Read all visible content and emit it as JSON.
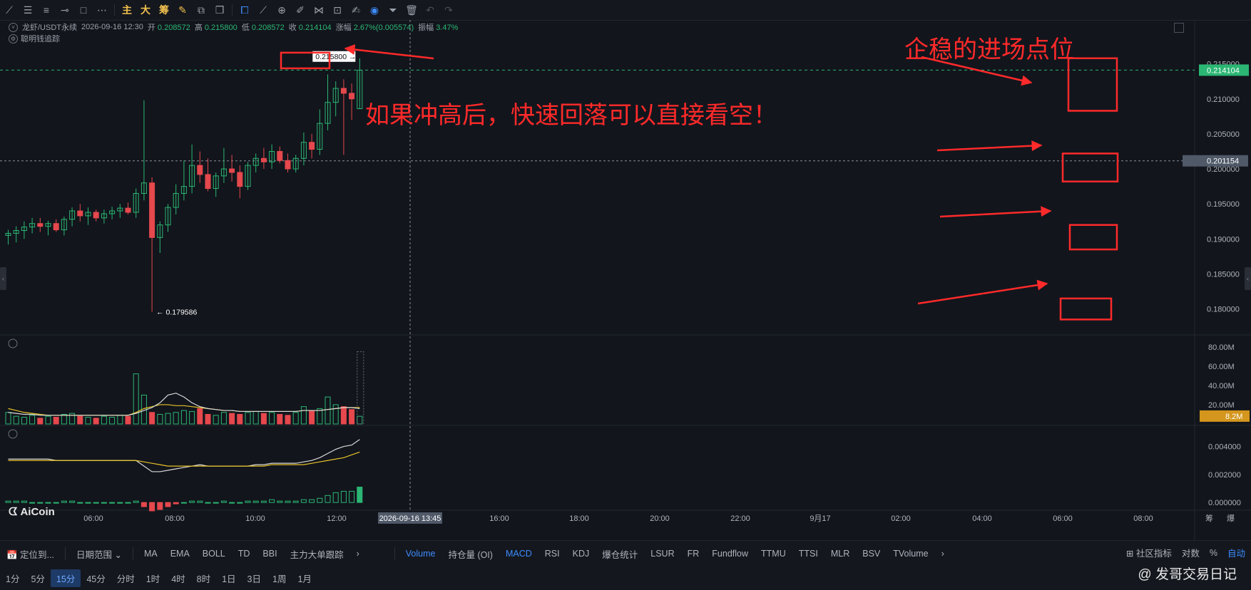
{
  "toolbar": {
    "icons": [
      "line-icon",
      "hline-icon",
      "parallel-icon",
      "ray-icon",
      "rect-icon",
      "dot-more-icon",
      "main-icon",
      "big-icon",
      "chip-icon",
      "pen-icon",
      "copy-icon",
      "layers-icon",
      "magnet-icon",
      "ruler-icon",
      "zoom-icon",
      "brush-icon",
      "mirror-icon",
      "lock-icon",
      "edit-icon",
      "eye-icon",
      "filter-icon",
      "trash-icon",
      "undo-icon",
      "redo-icon"
    ],
    "label_main": "主",
    "label_big": "大",
    "label_chip": "筹"
  },
  "info": {
    "symbol": "龙虾/USDT永续",
    "datetime": "2026-09-16 12:30",
    "open_label": "开",
    "open": "0.208572",
    "high_label": "高",
    "high": "0.215800",
    "low_label": "低",
    "low": "0.208572",
    "close_label": "收",
    "close": "0.214104",
    "change_label": "涨幅",
    "change": "2.67%(0.005574)",
    "amplitude_label": "振幅",
    "amplitude": "3.47%"
  },
  "indicator_label": "聪明钱追踪",
  "annotations": {
    "title": "企稳的进场点位",
    "note": "如果冲高后，快速回落可以直接看空！"
  },
  "chart_data": {
    "type": "candlestick",
    "interval": "15分",
    "price_axis": {
      "ticks": [
        "0.215000",
        "0.210000",
        "0.205000",
        "0.200000",
        "0.195000",
        "0.190000",
        "0.185000",
        "0.180000"
      ],
      "min": 0.1765,
      "max": 0.2172
    },
    "time_axis": {
      "ticks": [
        "06:00",
        "08:00",
        "10:00",
        "12:00",
        "2026-09-16 13:45",
        "16:00",
        "18:00",
        "20:00",
        "22:00",
        "9月17",
        "02:00",
        "04:00",
        "06:00",
        "08:00"
      ]
    },
    "current_price": "0.214104",
    "crosshair_price": "0.201154",
    "crosshair_time": "2026-09-16 13:45",
    "high_marker": "0.215800",
    "low_marker": "0.179586",
    "highlight_levels": [
      "0.214104 / 0.210000",
      "0.201154 / 0.200000",
      "0.190000",
      "0.180000"
    ],
    "candles": [
      [
        0.1905,
        0.1913,
        0.1892,
        0.1908
      ],
      [
        0.1908,
        0.1918,
        0.1895,
        0.1912
      ],
      [
        0.1912,
        0.1925,
        0.19,
        0.1917
      ],
      [
        0.1917,
        0.193,
        0.1908,
        0.1922
      ],
      [
        0.1922,
        0.193,
        0.191,
        0.1918
      ],
      [
        0.1918,
        0.1926,
        0.1905,
        0.1922
      ],
      [
        0.1922,
        0.1928,
        0.191,
        0.1913
      ],
      [
        0.1913,
        0.1932,
        0.1905,
        0.1928
      ],
      [
        0.1928,
        0.1945,
        0.1918,
        0.194
      ],
      [
        0.194,
        0.195,
        0.1925,
        0.1933
      ],
      [
        0.1933,
        0.1945,
        0.192,
        0.1938
      ],
      [
        0.1938,
        0.1942,
        0.1925,
        0.193
      ],
      [
        0.193,
        0.1942,
        0.1922,
        0.1936
      ],
      [
        0.1936,
        0.1946,
        0.1928,
        0.194
      ],
      [
        0.194,
        0.195,
        0.193,
        0.1944
      ],
      [
        0.1944,
        0.1952,
        0.1935,
        0.1938
      ],
      [
        0.1938,
        0.1972,
        0.193,
        0.1965
      ],
      [
        0.1965,
        0.2098,
        0.1955,
        0.198
      ],
      [
        0.198,
        0.1988,
        0.1796,
        0.1902
      ],
      [
        0.1902,
        0.1925,
        0.188,
        0.192
      ],
      [
        0.192,
        0.195,
        0.191,
        0.1945
      ],
      [
        0.1945,
        0.1978,
        0.1935,
        0.1965
      ],
      [
        0.1965,
        0.2012,
        0.1955,
        0.1975
      ],
      [
        0.1975,
        0.2035,
        0.1965,
        0.2005
      ],
      [
        0.2005,
        0.2025,
        0.198,
        0.1992
      ],
      [
        0.1992,
        0.2015,
        0.1968,
        0.1972
      ],
      [
        0.1972,
        0.1995,
        0.196,
        0.199
      ],
      [
        0.199,
        0.203,
        0.198,
        0.2
      ],
      [
        0.2,
        0.202,
        0.1982,
        0.1995
      ],
      [
        0.1995,
        0.2005,
        0.1958,
        0.1975
      ],
      [
        0.1975,
        0.201,
        0.197,
        0.2005
      ],
      [
        0.2005,
        0.2022,
        0.1995,
        0.2015
      ],
      [
        0.2015,
        0.203,
        0.2,
        0.201
      ],
      [
        0.201,
        0.2035,
        0.2,
        0.2025
      ],
      [
        0.2025,
        0.2032,
        0.2008,
        0.2012
      ],
      [
        0.2012,
        0.2022,
        0.1995,
        0.2
      ],
      [
        0.2,
        0.202,
        0.1995,
        0.2015
      ],
      [
        0.2015,
        0.2052,
        0.2005,
        0.2038
      ],
      [
        0.2038,
        0.205,
        0.2015,
        0.2028
      ],
      [
        0.2028,
        0.2085,
        0.202,
        0.2065
      ],
      [
        0.2065,
        0.2135,
        0.2055,
        0.2095
      ],
      [
        0.2095,
        0.2125,
        0.2075,
        0.2115
      ],
      [
        0.2115,
        0.2128,
        0.202,
        0.2108
      ],
      [
        0.2108,
        0.2122,
        0.207,
        0.21
      ],
      [
        0.2086,
        0.2158,
        0.2086,
        0.2141
      ]
    ],
    "volume_axis": {
      "ticks": [
        "80.00M",
        "60.00M",
        "40.00M",
        "20.00M"
      ],
      "max": 88,
      "current": "8.2M"
    },
    "volumes": [
      12,
      8,
      7,
      9,
      6,
      8,
      7,
      10,
      11,
      8,
      7,
      6,
      8,
      7,
      9,
      8,
      52,
      30,
      12,
      10,
      11,
      12,
      14,
      13,
      16,
      10,
      9,
      12,
      11,
      10,
      12,
      13,
      11,
      12,
      10,
      9,
      12,
      18,
      14,
      16,
      28,
      20,
      18,
      15,
      8
    ],
    "volume_ma1": [
      16,
      14,
      12,
      11,
      10,
      9,
      9,
      9,
      9,
      9,
      9,
      9,
      9,
      9,
      9,
      9,
      12,
      16,
      18,
      20,
      20,
      19,
      19,
      18,
      17,
      16,
      15,
      14,
      14,
      13,
      13,
      13,
      13,
      13,
      13,
      13,
      13,
      14,
      14,
      14,
      15,
      16,
      17,
      17,
      17
    ],
    "volume_ma2": [
      12,
      11,
      10,
      10,
      9,
      9,
      9,
      9,
      9,
      9,
      9,
      9,
      9,
      9,
      9,
      9,
      11,
      14,
      17,
      22,
      30,
      32,
      28,
      22,
      18,
      16,
      15,
      14,
      14,
      13,
      13,
      13,
      13,
      13,
      13,
      13,
      13,
      14,
      14,
      14,
      15,
      16,
      17,
      17,
      16
    ],
    "macd_axis": {
      "ticks": [
        "0.004000",
        "0.002000",
        "0.000000"
      ],
      "min": -0.0005,
      "max": 0.0052
    },
    "macd_hist": [
      0.0001,
      0.0001,
      0.0001,
      0.0,
      0.0,
      0.0,
      0.0,
      0.0001,
      0.0001,
      0.0,
      0.0,
      0.0,
      0.0,
      0.0,
      0.0,
      0.0,
      0.0001,
      -0.0003,
      -0.0006,
      -0.0005,
      -0.0003,
      -0.0001,
      0.0,
      0.0001,
      0.0001,
      0.0,
      0.0,
      0.0001,
      0.0,
      0.0,
      0.0001,
      0.0001,
      0.0001,
      0.0002,
      0.0001,
      0.0001,
      0.0001,
      0.0002,
      0.0002,
      0.0003,
      0.0005,
      0.0007,
      0.0008,
      0.0008,
      0.0011
    ],
    "macd_dif": [
      0.0031,
      0.0031,
      0.0031,
      0.0031,
      0.0031,
      0.0031,
      0.003,
      0.003,
      0.003,
      0.003,
      0.003,
      0.003,
      0.003,
      0.003,
      0.003,
      0.003,
      0.003,
      0.0026,
      0.0022,
      0.0022,
      0.0023,
      0.0024,
      0.0025,
      0.0026,
      0.0027,
      0.0026,
      0.0026,
      0.0026,
      0.0026,
      0.0026,
      0.0026,
      0.0027,
      0.0027,
      0.0028,
      0.0028,
      0.0028,
      0.0028,
      0.0029,
      0.003,
      0.0032,
      0.0035,
      0.0038,
      0.004,
      0.0041,
      0.0045
    ],
    "macd_dea": [
      0.003,
      0.003,
      0.003,
      0.003,
      0.003,
      0.003,
      0.003,
      0.003,
      0.003,
      0.003,
      0.003,
      0.003,
      0.003,
      0.003,
      0.003,
      0.003,
      0.003,
      0.0029,
      0.0028,
      0.0027,
      0.0026,
      0.0026,
      0.0026,
      0.0026,
      0.0026,
      0.0026,
      0.0026,
      0.0026,
      0.0026,
      0.0026,
      0.0026,
      0.0026,
      0.0026,
      0.0027,
      0.0027,
      0.0027,
      0.0027,
      0.0027,
      0.0028,
      0.0029,
      0.003,
      0.0031,
      0.0032,
      0.0034,
      0.0036
    ]
  },
  "colors": {
    "up": "#2bb673",
    "down": "#e5484d",
    "annot": "#ff2a2a",
    "bg": "#12151c",
    "accent": "#3d8cff"
  },
  "logo": "AiCoin",
  "bottom_bar": {
    "locate": "定位到...",
    "date_range": "日期范围",
    "main_indicators": [
      "MA",
      "EMA",
      "BOLL",
      "TD",
      "BBI",
      "主力大单跟踪"
    ],
    "sub_indicators": [
      "Volume",
      "持仓量 (OI)",
      "MACD",
      "RSI",
      "KDJ",
      "爆仓统计",
      "LSUR",
      "FR",
      "Fundflow",
      "TTMU",
      "TTSI",
      "MLR",
      "BSV",
      "TVolume"
    ],
    "right_tools": [
      "社区指标",
      "对数",
      "%",
      "自动"
    ],
    "axis_corner": [
      "筹",
      "爆"
    ]
  },
  "timeframes": [
    "1分",
    "5分",
    "15分",
    "45分",
    "分时",
    "1时",
    "4时",
    "8时",
    "1日",
    "3日",
    "1周",
    "1月"
  ],
  "active_timeframe": "15分",
  "watermark": "@ 发哥交易日记"
}
